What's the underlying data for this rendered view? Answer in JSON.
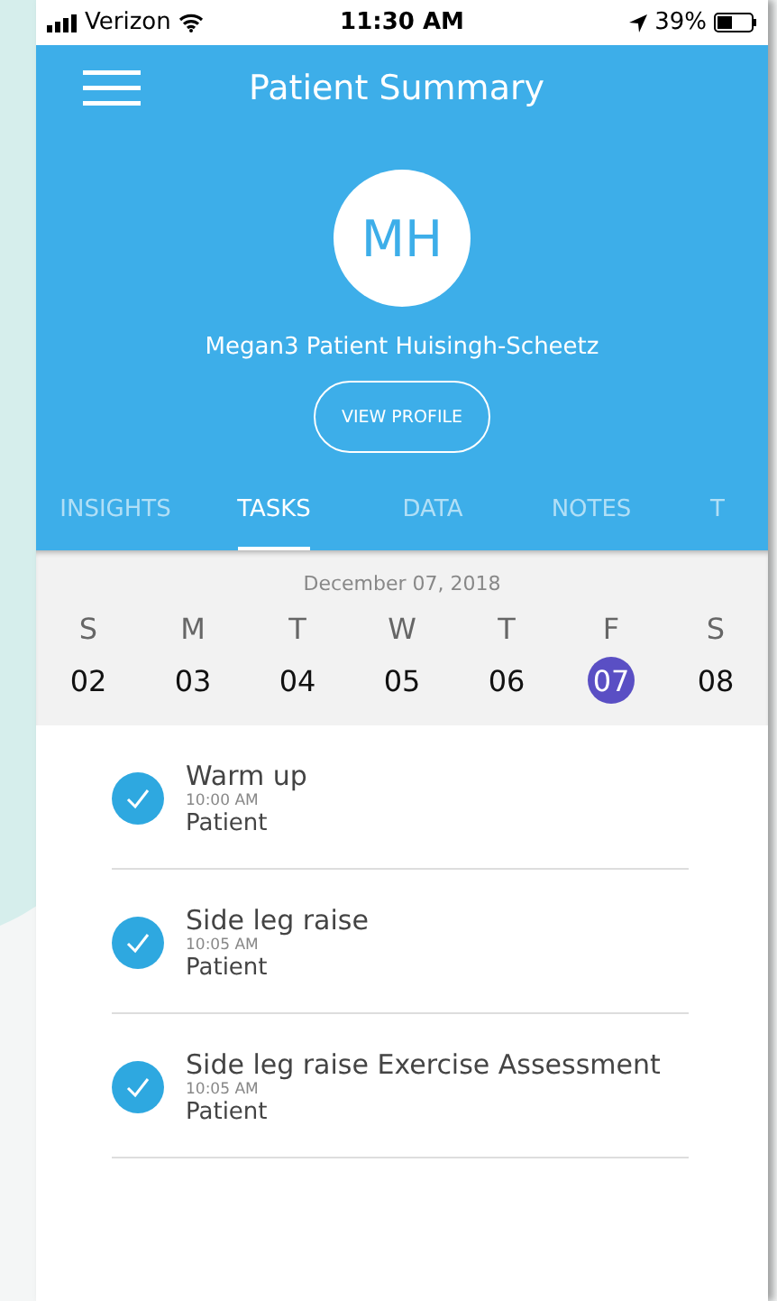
{
  "status_bar": {
    "carrier": "Verizon",
    "time": "11:30 AM",
    "battery": "39%"
  },
  "header": {
    "title": "Patient Summary",
    "initials": "MH",
    "patient_name": "Megan3 Patient Huisingh-Scheetz",
    "profile_button": "VIEW PROFILE"
  },
  "tabs": [
    {
      "label": "INSIGHTS",
      "selected": false
    },
    {
      "label": "TASKS",
      "selected": true
    },
    {
      "label": "DATA",
      "selected": false
    },
    {
      "label": "NOTES",
      "selected": false
    },
    {
      "label": "T",
      "selected": false
    }
  ],
  "calendar": {
    "date": "December 07, 2018",
    "days": [
      {
        "weekday": "S",
        "date": "02",
        "selected": false
      },
      {
        "weekday": "M",
        "date": "03",
        "selected": false
      },
      {
        "weekday": "T",
        "date": "04",
        "selected": false
      },
      {
        "weekday": "W",
        "date": "05",
        "selected": false
      },
      {
        "weekday": "T",
        "date": "06",
        "selected": false
      },
      {
        "weekday": "F",
        "date": "07",
        "selected": true
      },
      {
        "weekday": "S",
        "date": "08",
        "selected": false
      }
    ]
  },
  "tasks": [
    {
      "title": "Warm up",
      "time": "10:00 AM",
      "assignee": "Patient",
      "checked": true
    },
    {
      "title": "Side leg raise",
      "time": "10:05 AM",
      "assignee": "Patient",
      "checked": true
    },
    {
      "title": "Side leg raise Exercise Assessment",
      "time": "10:05 AM",
      "assignee": "Patient",
      "checked": true
    }
  ]
}
